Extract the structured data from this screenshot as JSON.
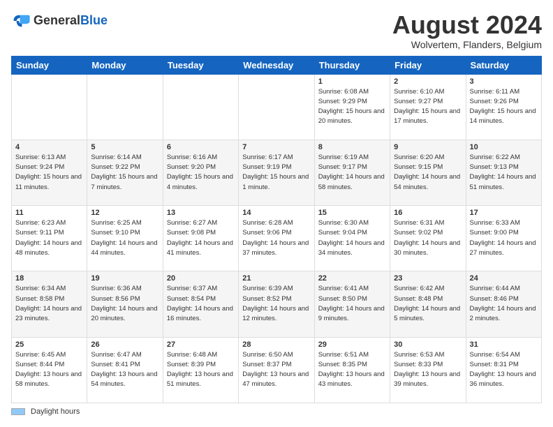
{
  "header": {
    "logo": {
      "general": "General",
      "blue": "Blue"
    },
    "title": "August 2024",
    "location": "Wolvertem, Flanders, Belgium"
  },
  "calendar": {
    "days_of_week": [
      "Sunday",
      "Monday",
      "Tuesday",
      "Wednesday",
      "Thursday",
      "Friday",
      "Saturday"
    ],
    "weeks": [
      [
        {
          "day": "",
          "info": ""
        },
        {
          "day": "",
          "info": ""
        },
        {
          "day": "",
          "info": ""
        },
        {
          "day": "",
          "info": ""
        },
        {
          "day": "1",
          "info": "Sunrise: 6:08 AM\nSunset: 9:29 PM\nDaylight: 15 hours and 20 minutes."
        },
        {
          "day": "2",
          "info": "Sunrise: 6:10 AM\nSunset: 9:27 PM\nDaylight: 15 hours and 17 minutes."
        },
        {
          "day": "3",
          "info": "Sunrise: 6:11 AM\nSunset: 9:26 PM\nDaylight: 15 hours and 14 minutes."
        }
      ],
      [
        {
          "day": "4",
          "info": "Sunrise: 6:13 AM\nSunset: 9:24 PM\nDaylight: 15 hours and 11 minutes."
        },
        {
          "day": "5",
          "info": "Sunrise: 6:14 AM\nSunset: 9:22 PM\nDaylight: 15 hours and 7 minutes."
        },
        {
          "day": "6",
          "info": "Sunrise: 6:16 AM\nSunset: 9:20 PM\nDaylight: 15 hours and 4 minutes."
        },
        {
          "day": "7",
          "info": "Sunrise: 6:17 AM\nSunset: 9:19 PM\nDaylight: 15 hours and 1 minute."
        },
        {
          "day": "8",
          "info": "Sunrise: 6:19 AM\nSunset: 9:17 PM\nDaylight: 14 hours and 58 minutes."
        },
        {
          "day": "9",
          "info": "Sunrise: 6:20 AM\nSunset: 9:15 PM\nDaylight: 14 hours and 54 minutes."
        },
        {
          "day": "10",
          "info": "Sunrise: 6:22 AM\nSunset: 9:13 PM\nDaylight: 14 hours and 51 minutes."
        }
      ],
      [
        {
          "day": "11",
          "info": "Sunrise: 6:23 AM\nSunset: 9:11 PM\nDaylight: 14 hours and 48 minutes."
        },
        {
          "day": "12",
          "info": "Sunrise: 6:25 AM\nSunset: 9:10 PM\nDaylight: 14 hours and 44 minutes."
        },
        {
          "day": "13",
          "info": "Sunrise: 6:27 AM\nSunset: 9:08 PM\nDaylight: 14 hours and 41 minutes."
        },
        {
          "day": "14",
          "info": "Sunrise: 6:28 AM\nSunset: 9:06 PM\nDaylight: 14 hours and 37 minutes."
        },
        {
          "day": "15",
          "info": "Sunrise: 6:30 AM\nSunset: 9:04 PM\nDaylight: 14 hours and 34 minutes."
        },
        {
          "day": "16",
          "info": "Sunrise: 6:31 AM\nSunset: 9:02 PM\nDaylight: 14 hours and 30 minutes."
        },
        {
          "day": "17",
          "info": "Sunrise: 6:33 AM\nSunset: 9:00 PM\nDaylight: 14 hours and 27 minutes."
        }
      ],
      [
        {
          "day": "18",
          "info": "Sunrise: 6:34 AM\nSunset: 8:58 PM\nDaylight: 14 hours and 23 minutes."
        },
        {
          "day": "19",
          "info": "Sunrise: 6:36 AM\nSunset: 8:56 PM\nDaylight: 14 hours and 20 minutes."
        },
        {
          "day": "20",
          "info": "Sunrise: 6:37 AM\nSunset: 8:54 PM\nDaylight: 14 hours and 16 minutes."
        },
        {
          "day": "21",
          "info": "Sunrise: 6:39 AM\nSunset: 8:52 PM\nDaylight: 14 hours and 12 minutes."
        },
        {
          "day": "22",
          "info": "Sunrise: 6:41 AM\nSunset: 8:50 PM\nDaylight: 14 hours and 9 minutes."
        },
        {
          "day": "23",
          "info": "Sunrise: 6:42 AM\nSunset: 8:48 PM\nDaylight: 14 hours and 5 minutes."
        },
        {
          "day": "24",
          "info": "Sunrise: 6:44 AM\nSunset: 8:46 PM\nDaylight: 14 hours and 2 minutes."
        }
      ],
      [
        {
          "day": "25",
          "info": "Sunrise: 6:45 AM\nSunset: 8:44 PM\nDaylight: 13 hours and 58 minutes."
        },
        {
          "day": "26",
          "info": "Sunrise: 6:47 AM\nSunset: 8:41 PM\nDaylight: 13 hours and 54 minutes."
        },
        {
          "day": "27",
          "info": "Sunrise: 6:48 AM\nSunset: 8:39 PM\nDaylight: 13 hours and 51 minutes."
        },
        {
          "day": "28",
          "info": "Sunrise: 6:50 AM\nSunset: 8:37 PM\nDaylight: 13 hours and 47 minutes."
        },
        {
          "day": "29",
          "info": "Sunrise: 6:51 AM\nSunset: 8:35 PM\nDaylight: 13 hours and 43 minutes."
        },
        {
          "day": "30",
          "info": "Sunrise: 6:53 AM\nSunset: 8:33 PM\nDaylight: 13 hours and 39 minutes."
        },
        {
          "day": "31",
          "info": "Sunrise: 6:54 AM\nSunset: 8:31 PM\nDaylight: 13 hours and 36 minutes."
        }
      ]
    ]
  },
  "footer": {
    "legend_label": "Daylight hours"
  }
}
